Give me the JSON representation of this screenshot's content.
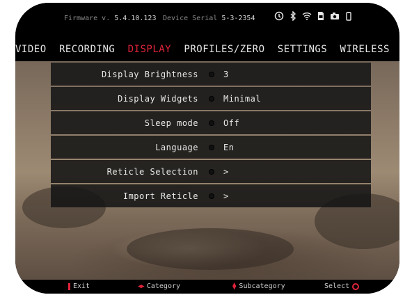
{
  "status": {
    "firmware_label": "Firmware v.",
    "firmware_version": "5.4.10.123",
    "serial_label": "Device Serial",
    "serial_value": "5-3-2354",
    "icons": [
      "timer-icon",
      "bluetooth-icon",
      "wifi-icon",
      "sd-card-icon",
      "camera-icon",
      "battery-icon"
    ]
  },
  "tabs": [
    {
      "label": "VIDEO"
    },
    {
      "label": "RECORDING"
    },
    {
      "label": "DISPLAY",
      "active": true
    },
    {
      "label": "PROFILES/ZERO"
    },
    {
      "label": "SETTINGS"
    },
    {
      "label": "WIRELESS"
    }
  ],
  "menu": [
    {
      "label": "Display Brightness",
      "value": "3"
    },
    {
      "label": "Display Widgets",
      "value": "Minimal"
    },
    {
      "label": "Sleep mode",
      "value": "Off"
    },
    {
      "label": "Language",
      "value": "En"
    },
    {
      "label": "Reticle Selection",
      "value": ">"
    },
    {
      "label": "Import Reticle",
      "value": ">"
    }
  ],
  "hints": {
    "exit": "Exit",
    "category": "Category",
    "subcategory": "Subcategory",
    "select": "Select"
  },
  "colors": {
    "accent": "#e0233a",
    "text": "#e8e8e8",
    "row_bg": "#161616"
  }
}
